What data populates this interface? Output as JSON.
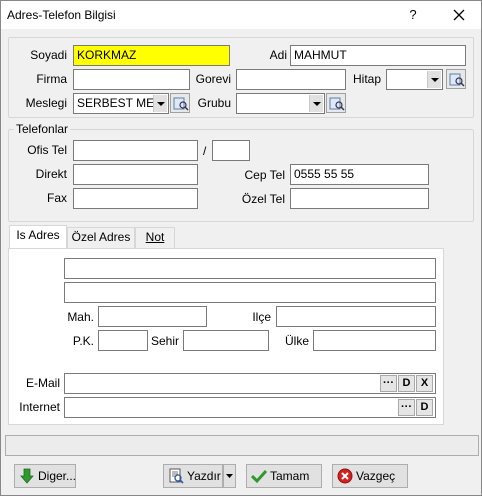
{
  "window": {
    "title": "Adres-Telefon Bilgisi",
    "help_label": "?",
    "close_label": "×"
  },
  "person": {
    "surname_label": "Soyadi",
    "surname_value": "KORKMAZ",
    "name_label": "Adi",
    "name_value": "MAHMUT",
    "company_label": "Firma",
    "company_value": "",
    "position_label": "Gorevi",
    "position_value": "",
    "title_label": "Hitap",
    "title_value": "",
    "profession_label": "Meslegi",
    "profession_value": "SERBEST ME",
    "group_label": "Grubu",
    "group_value": ""
  },
  "phones": {
    "section_title": "Telefonlar",
    "office_label": "Ofis Tel",
    "office_value": "",
    "ext_separator": "/",
    "ext_value": "",
    "direct_label": "Direkt",
    "direct_value": "",
    "mobile_label": "Cep Tel",
    "mobile_value": "0555 55 55",
    "fax_label": "Fax",
    "fax_value": "",
    "private_label": "Özel Tel",
    "private_value": ""
  },
  "tabs": [
    {
      "label": "Is Adres",
      "active": true
    },
    {
      "label": "Özel Adres",
      "active": false
    },
    {
      "label": "Not",
      "active": false
    }
  ],
  "address": {
    "line1_value": "",
    "line2_value": "",
    "district_label": "Mah.",
    "district_value": "",
    "county_label": "Ilçe",
    "county_value": "",
    "postal_label": "P.K.",
    "postal_value": "",
    "city_label": "Sehir",
    "city_value": "",
    "country_label": "Ülke",
    "country_value": "",
    "email_label": "E-Mail",
    "email_value": "",
    "internet_label": "Internet",
    "internet_value": "",
    "ellipsis_label": "···",
    "d_label": "D",
    "x_label": "X"
  },
  "status": {
    "text": ""
  },
  "buttons": {
    "other_label": "Diger...",
    "print_label": "Yazdır",
    "ok_label": "Tamam",
    "cancel_label": "Vazgeç"
  },
  "colors": {
    "highlight_field": "#ffff00",
    "ok_icon": "#2e9a2e",
    "cancel_icon": "#d32020",
    "down_arrow": "#2e9a2e"
  }
}
